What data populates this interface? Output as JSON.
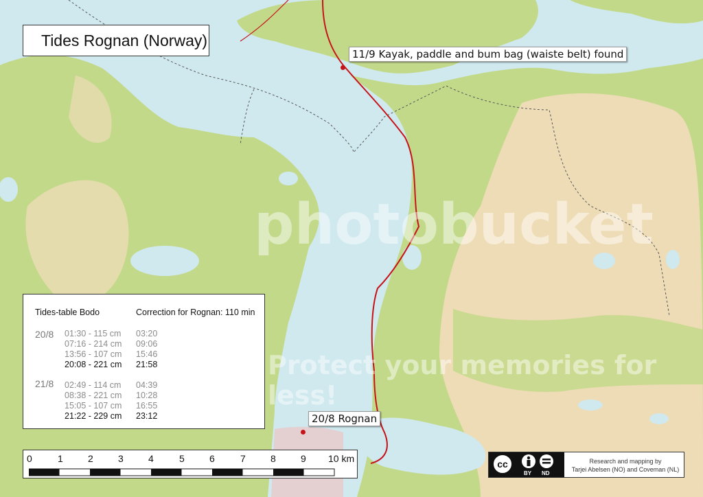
{
  "title": "Tides Rognan (Norway)",
  "callouts": {
    "kayak": "11/9 Kayak, paddle and bum bag (waiste belt) found",
    "rognan": "20/8 Rognan"
  },
  "tides": {
    "header_left": "Tides-table Bodo",
    "header_right": "Correction for Rognan: 110 min",
    "days": [
      {
        "date": "20/8",
        "rows": [
          {
            "tide": "01:30 - 115 cm",
            "corrected": "03:20"
          },
          {
            "tide": "07:16 - 214 cm",
            "corrected": "09:06"
          },
          {
            "tide": "13:56 - 107 cm",
            "corrected": "15:46"
          },
          {
            "tide": "20:08 - 221 cm",
            "corrected": "21:58"
          }
        ]
      },
      {
        "date": "21/8",
        "rows": [
          {
            "tide": "02:49 - 114 cm",
            "corrected": "04:39"
          },
          {
            "tide": "08:38 - 221 cm",
            "corrected": "10:28"
          },
          {
            "tide": "15:05 - 107 cm",
            "corrected": "16:55"
          },
          {
            "tide": "21:22 - 229 cm",
            "corrected": "23:12"
          }
        ]
      }
    ]
  },
  "scale": {
    "labels": [
      "0",
      "1",
      "2",
      "3",
      "4",
      "5",
      "6",
      "7",
      "8",
      "9",
      "10 km"
    ]
  },
  "credit": {
    "license": "cc BY ND",
    "by": "BY",
    "nd": "ND",
    "line1": "Research and mapping by",
    "line2": "Tarjei Abelsen (NO) and Coveman (NL)"
  },
  "watermark": {
    "main": "photobucket",
    "sub": "Protect your memories for less!"
  },
  "colors": {
    "water": "#cfe9ee",
    "forest": "#c3d98a",
    "open_land": "#eedcb6",
    "road": "#c4141a",
    "pin": "#c4141a"
  }
}
